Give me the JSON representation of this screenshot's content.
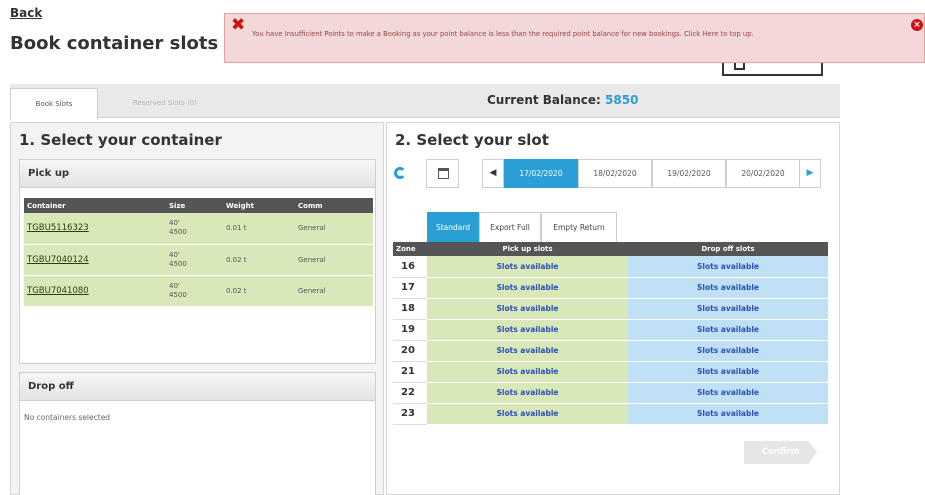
{
  "header": {
    "back_label": "Back",
    "title": "Book container slots"
  },
  "error": {
    "message": "You have Insufficient Points to make a Booking as your point balance is less than the required point balance for new bookings. Click Here to top up."
  },
  "tabs": [
    {
      "label": "Book Slots"
    },
    {
      "label": "Reserved Slots (0)"
    }
  ],
  "balance": {
    "label": "Current Balance:",
    "value": "5850"
  },
  "left": {
    "title": "1. Select your container",
    "pickup": {
      "header": "Pick up",
      "columns": [
        "Container",
        "Size",
        "Weight",
        "Comm"
      ],
      "rows": [
        {
          "container": "TGBU5116323",
          "size_line1": "40'",
          "size_line2": "4500",
          "weight": "0.01 t",
          "comm": "General"
        },
        {
          "container": "TGBU7040124",
          "size_line1": "40'",
          "size_line2": "4500",
          "weight": "0.02 t",
          "comm": "General"
        },
        {
          "container": "TGBU7041080",
          "size_line1": "40'",
          "size_line2": "4500",
          "weight": "0.02 t",
          "comm": "General"
        }
      ]
    },
    "dropoff": {
      "header": "Drop off",
      "empty_text": "No containers selected"
    }
  },
  "right": {
    "title": "2. Select your slot",
    "dates": [
      "17/02/2020",
      "18/02/2020",
      "19/02/2020",
      "20/02/2020"
    ],
    "selected_date": "17/02/2020",
    "slot_tabs": [
      "Standard",
      "Export Full",
      "Empty Return"
    ],
    "table": {
      "columns": [
        "Zone",
        "Pick up slots",
        "Drop off slots"
      ],
      "rows": [
        {
          "zone": "16",
          "pickup": "Slots available",
          "dropoff": "Slots available"
        },
        {
          "zone": "17",
          "pickup": "Slots available",
          "dropoff": "Slots available"
        },
        {
          "zone": "18",
          "pickup": "Slots available",
          "dropoff": "Slots available"
        },
        {
          "zone": "19",
          "pickup": "Slots available",
          "dropoff": "Slots available"
        },
        {
          "zone": "20",
          "pickup": "Slots available",
          "dropoff": "Slots available"
        },
        {
          "zone": "21",
          "pickup": "Slots available",
          "dropoff": "Slots available"
        },
        {
          "zone": "22",
          "pickup": "Slots available",
          "dropoff": "Slots available"
        },
        {
          "zone": "23",
          "pickup": "Slots available",
          "dropoff": "Slots available"
        }
      ]
    },
    "confirm_label": "Confirm"
  },
  "icons": {
    "error": "x-icon",
    "close": "close-icon",
    "refresh": "refresh-icon",
    "calendar": "calendar-icon",
    "prev": "chevron-left-icon",
    "next": "chevron-right-icon"
  },
  "colors": {
    "accent": "#2a9fd6",
    "pickup_bg": "#d9e8b8",
    "dropoff_bg": "#bfe0f5",
    "error_bg": "#f2d8d8",
    "error_icon": "#cc1111",
    "table_header": "#555555"
  }
}
